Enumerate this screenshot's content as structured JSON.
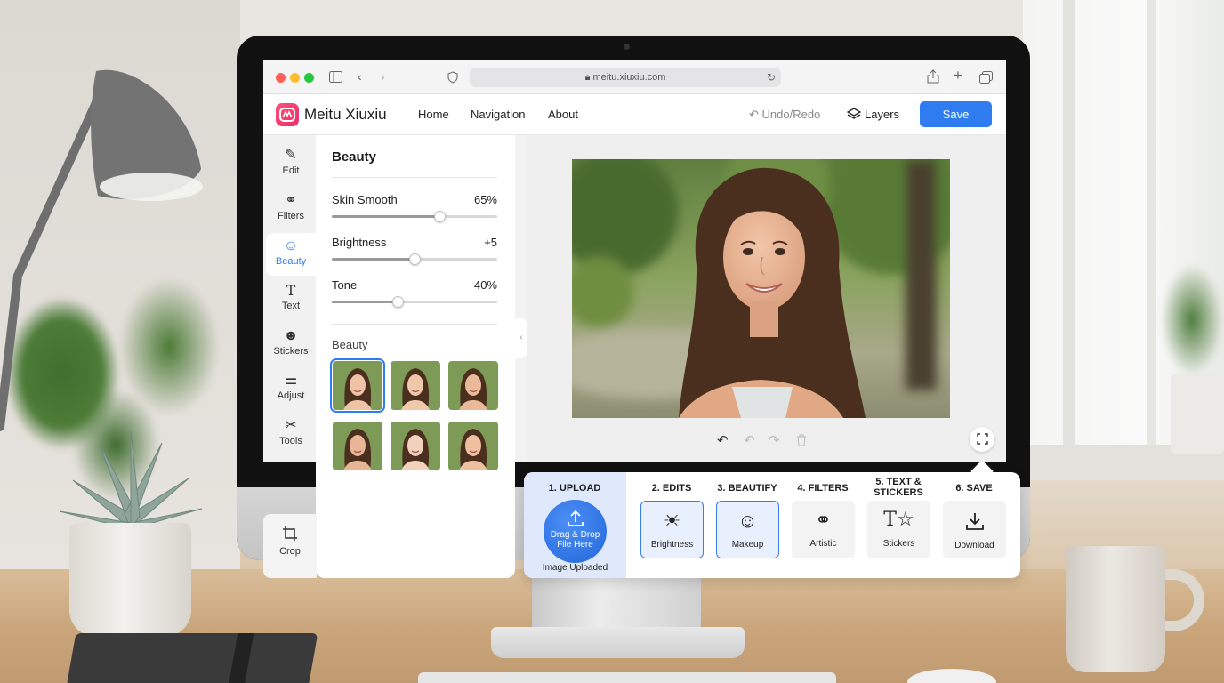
{
  "browser": {
    "url": "meitu.xiuxiu.com",
    "traffic_colors": [
      "#ff5f57",
      "#febc2e",
      "#28c840"
    ]
  },
  "app": {
    "title": "Meitu Xiuxiu",
    "nav": [
      "Home",
      "Navigation",
      "About"
    ],
    "undo_redo": "Undo/Redo",
    "layers": "Layers",
    "save": "Save",
    "accent": "#2f7bf0",
    "brand": "#e6306a"
  },
  "rail": {
    "items": [
      {
        "label": "Edit",
        "icon": "edit-icon"
      },
      {
        "label": "Filters",
        "icon": "filters-icon"
      },
      {
        "label": "Beauty",
        "icon": "beauty-face-icon",
        "active": true
      },
      {
        "label": "Text",
        "icon": "text-icon"
      },
      {
        "label": "Stickers",
        "icon": "sticker-icon"
      },
      {
        "label": "Adjust",
        "icon": "sliders-icon"
      },
      {
        "label": "Tools",
        "icon": "tools-icon"
      }
    ],
    "crop": {
      "label": "Crop",
      "icon": "crop-icon"
    }
  },
  "panel": {
    "title": "Beauty",
    "sliders": [
      {
        "label": "Skin Smooth",
        "value": "65%",
        "level": 0.65
      },
      {
        "label": "Brightness",
        "value": "+5",
        "level": 0.5
      },
      {
        "label": "Tone",
        "value": "40%",
        "level": 0.4
      }
    ],
    "presets_title": "Beauty",
    "selected_preset": 1,
    "preset_count": 6
  },
  "canvas": {
    "history_icons": [
      "undo-icon",
      "undo-disabled-icon",
      "redo-icon",
      "delete-icon"
    ],
    "fullscreen_icon": "fullscreen-icon"
  },
  "workflow": {
    "steps": [
      {
        "title": "1. UPLOAD"
      },
      {
        "title": "2. EDITS",
        "tile": "Brightness",
        "icon": "brightness-icon",
        "highlight": true
      },
      {
        "title": "3. BEAUTIFY",
        "tile": "Makeup",
        "icon": "makeup-face-icon",
        "highlight": true
      },
      {
        "title": "4. FILTERS",
        "tile": "Artistic",
        "icon": "artistic-icon",
        "highlight": false
      },
      {
        "title": "5. TEXT & STICKERS",
        "tile": "Stickers",
        "icon": "text-sticker-icon",
        "highlight": false
      },
      {
        "title": "6. SAVE",
        "tile": "Download",
        "icon": "download-icon",
        "highlight": false
      }
    ],
    "drop_text_1": "Drag & Drop",
    "drop_text_2": "File Here",
    "upload_status": "Image Uploaded"
  }
}
